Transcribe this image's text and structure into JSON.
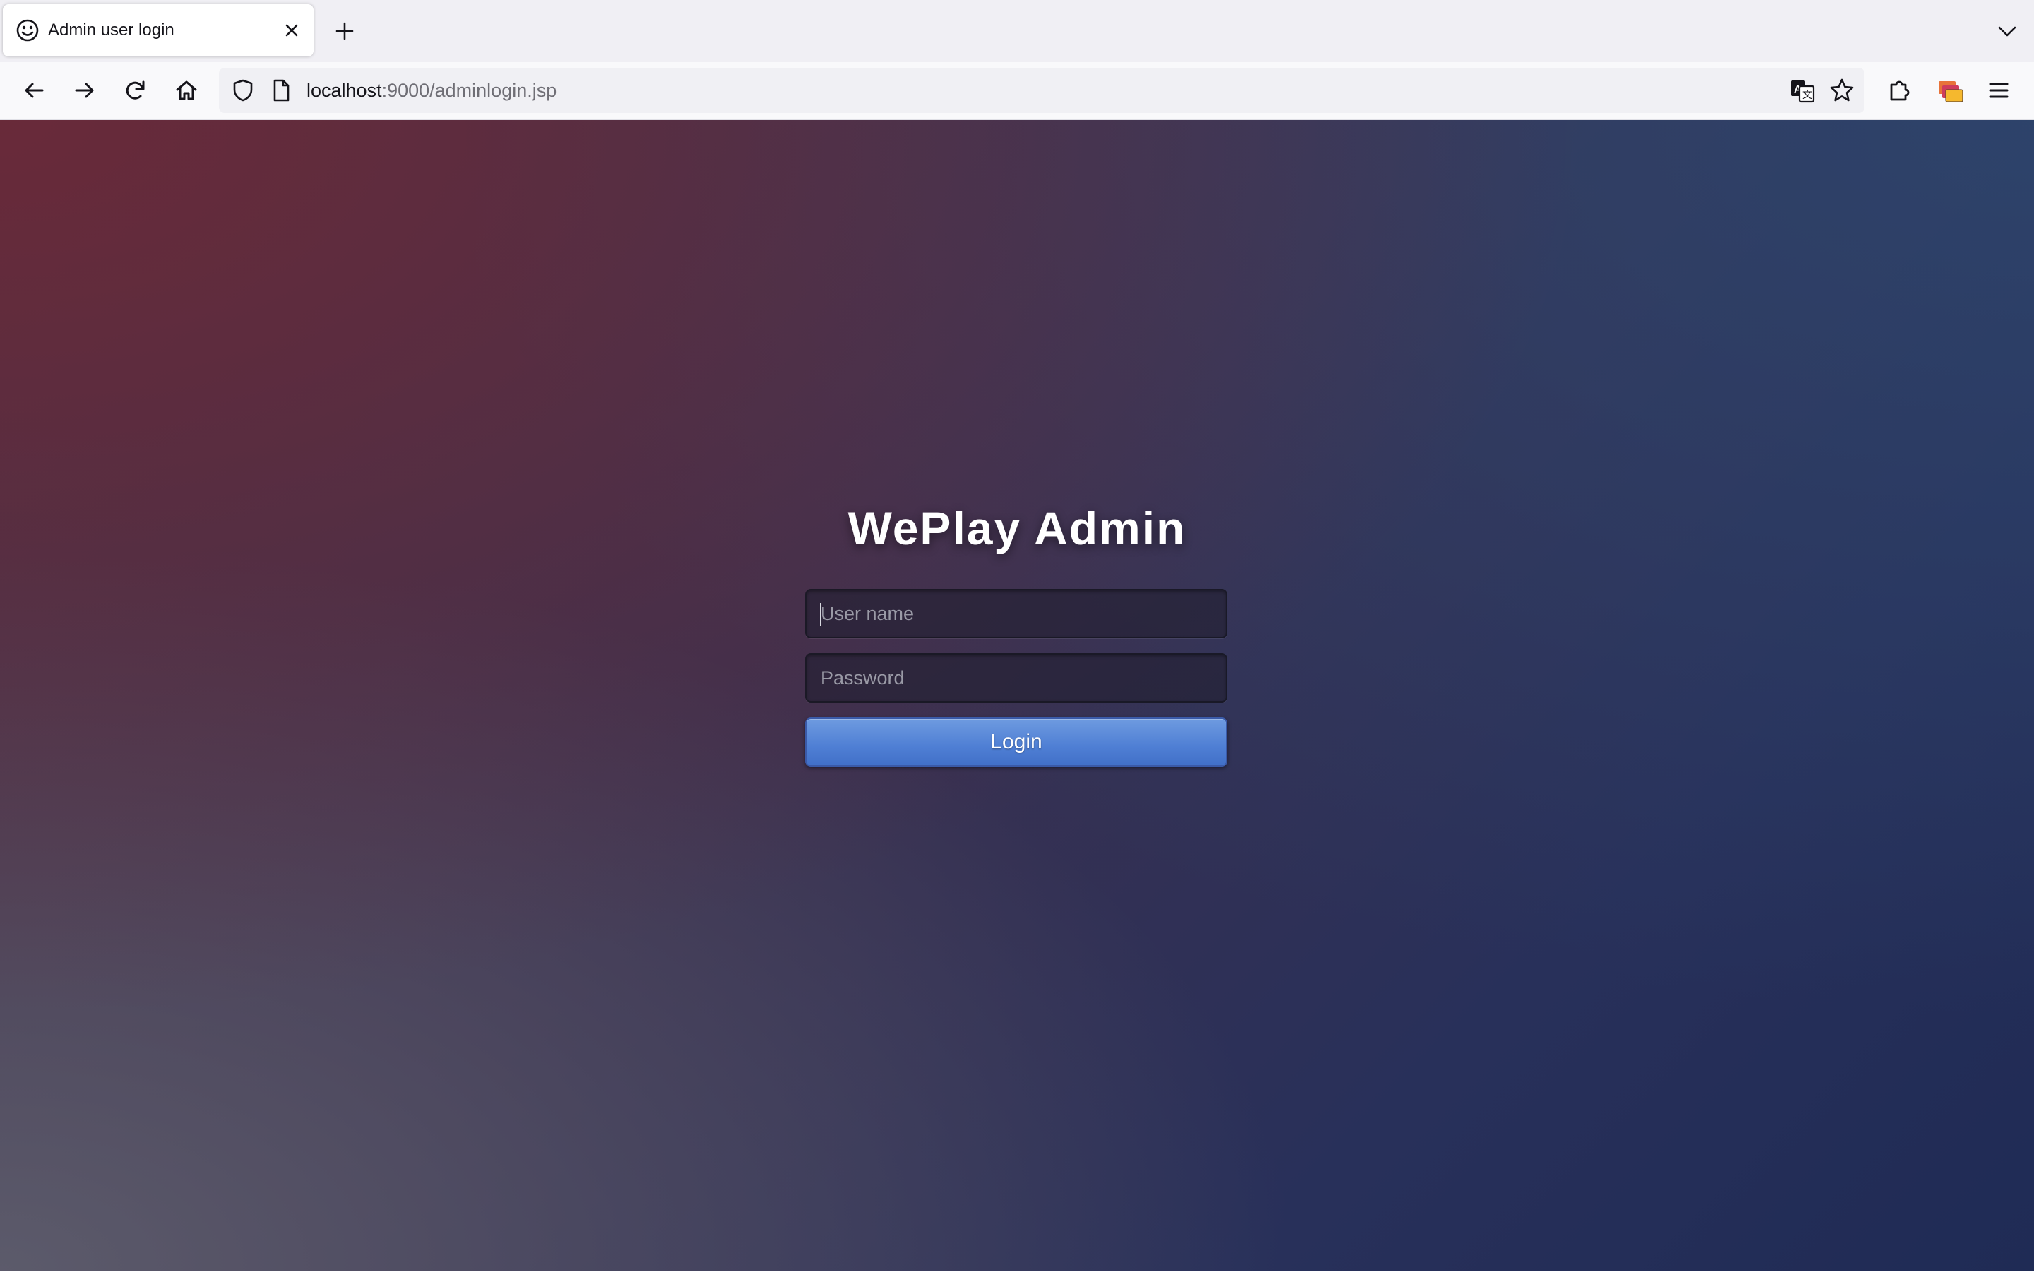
{
  "browser": {
    "tab": {
      "title": "Admin user login",
      "favicon": "smiley-icon"
    },
    "url": {
      "host": "localhost",
      "rest": ":9000/adminlogin.jsp"
    },
    "icons": {
      "back": "arrow-left-icon",
      "forward": "arrow-right-icon",
      "reload": "reload-icon",
      "home": "home-icon",
      "tracking_protection": "shield-icon",
      "page_info": "page-icon",
      "translate": "translate-icon",
      "bookmark": "star-icon",
      "extensions": "puzzle-icon",
      "multi_account": "multi-account-icon",
      "menu": "hamburger-menu-icon",
      "new_tab": "plus-icon",
      "close_tab": "close-icon",
      "tab_list": "chevron-down-icon"
    }
  },
  "login": {
    "title": "WePlay Admin",
    "username_placeholder": "User name",
    "username_value": "",
    "password_placeholder": "Password",
    "password_value": "",
    "button_label": "Login"
  },
  "colors": {
    "accent": "#4f7fd4",
    "background_dark": "#1f2b55",
    "background_warm": "#6e2837"
  }
}
